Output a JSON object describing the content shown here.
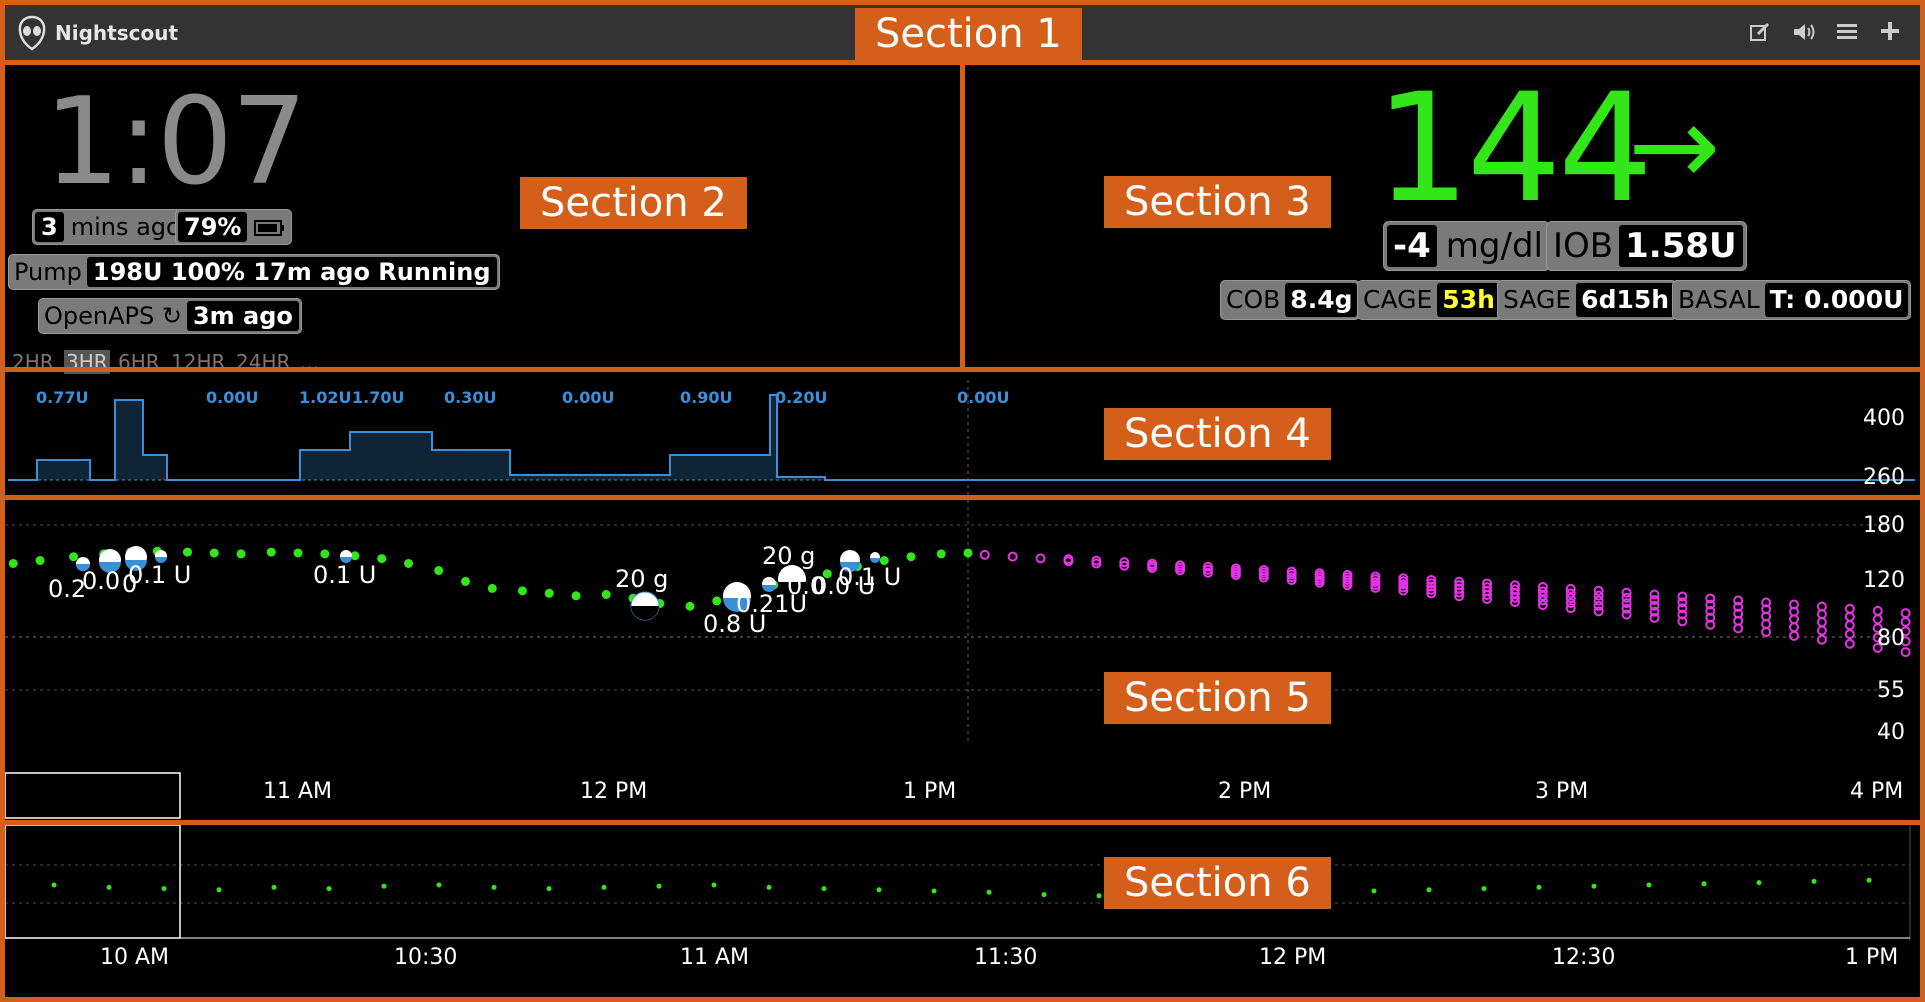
{
  "app": {
    "title": "Nightscout"
  },
  "toolbar": {
    "icons": [
      "edit-icon",
      "speaker-icon",
      "menu-icon",
      "plus-icon"
    ]
  },
  "sections": [
    "Section 1",
    "Section 2",
    "Section 3",
    "Section 4",
    "Section 5",
    "Section 6"
  ],
  "clock": {
    "time": "1:07",
    "last_reading": {
      "value": "3",
      "label": "mins ago"
    },
    "battery": {
      "value": "79%"
    },
    "pump": {
      "label": "Pump",
      "value": "198U 100% 17m ago Running"
    },
    "openaps": {
      "label": "OpenAPS ↻",
      "value": "3m ago"
    },
    "ranges": [
      "2HR",
      "3HR",
      "6HR",
      "12HR",
      "24HR",
      "..."
    ],
    "active_range": "3HR"
  },
  "bg": {
    "value": "144",
    "arrow": "→",
    "delta": {
      "value": "-4",
      "unit": "mg/dl"
    },
    "iob": {
      "label": "IOB",
      "value": "1.58U"
    },
    "cob": {
      "label": "COB",
      "value": "8.4g"
    },
    "cage": {
      "label": "CAGE",
      "value": "53h"
    },
    "sage": {
      "label": "SAGE",
      "value": "6d15h"
    },
    "basal": {
      "label": "BASAL",
      "value": "T: 0.000U"
    },
    "color": "#33e61a"
  },
  "basal_labels": [
    "0.77U",
    "0.00U",
    "1.02U",
    "1.70U",
    "0.30U",
    "0.00U",
    "0.90U",
    "0.20U",
    "0.00U"
  ],
  "chart_data": [
    {
      "type": "line",
      "title": "",
      "ylim": [
        0,
        400
      ],
      "y_ticks": [
        "400",
        "260"
      ],
      "series": [
        {
          "values": [
            0.77,
            0.0,
            1.02,
            1.7,
            0.3,
            0.0,
            0.9,
            0.2,
            0.0
          ]
        }
      ]
    },
    {
      "type": "scatter",
      "title": "",
      "y_scale": "log",
      "y_ticks": [
        "180",
        "120",
        "80",
        "55",
        "40"
      ],
      "x_ticks": [
        "11 AM",
        "12 PM",
        "1 PM",
        "2 PM",
        "3 PM",
        "4 PM"
      ],
      "treatments": [
        "0.1 U",
        "0.2",
        "0.0",
        "0",
        "0.1 U",
        "20 g",
        "0.8 U",
        "20 g",
        "0.21U",
        "0.0",
        "0.0 U",
        "0.1 U"
      ],
      "bg_series": {
        "color": "#33e61a",
        "x": [
          10.07,
          10.15,
          10.23,
          10.33,
          10.42,
          10.5,
          10.58,
          10.67,
          10.75,
          10.83,
          10.92,
          11.0,
          11.08,
          11.17,
          11.25,
          11.33,
          11.42,
          11.5,
          11.58,
          11.67,
          11.75,
          11.83,
          11.92,
          12.0,
          12.08,
          12.17,
          12.25,
          12.33,
          12.42,
          12.5,
          12.58,
          12.67,
          12.75,
          12.83,
          12.92,
          13.0
        ],
        "y": [
          130,
          135,
          138,
          142,
          145,
          147,
          148,
          147,
          146,
          145,
          147,
          146,
          145,
          143,
          140,
          135,
          128,
          118,
          112,
          110,
          108,
          106,
          107,
          104,
          100,
          98,
          102,
          108,
          115,
          120,
          125,
          132,
          138,
          142,
          145,
          146
        ]
      },
      "forecast": {
        "color": "#e633e6",
        "from": 144,
        "to_range": [
          65,
          90
        ]
      }
    },
    {
      "type": "scatter",
      "title": "",
      "x_ticks": [
        "10 AM",
        "10:30",
        "11 AM",
        "11:30",
        "12 PM",
        "12:30",
        "1 PM"
      ],
      "series": [
        {
          "color": "#33e61a",
          "values": [
            130,
            128,
            127,
            126,
            128,
            127,
            129,
            130,
            128,
            127,
            128,
            129,
            130,
            128,
            127,
            126,
            125,
            124,
            122,
            121,
            120,
            122,
            123,
            124,
            125,
            126,
            127,
            128,
            129,
            130,
            131,
            132,
            133,
            134
          ]
        }
      ]
    }
  ]
}
